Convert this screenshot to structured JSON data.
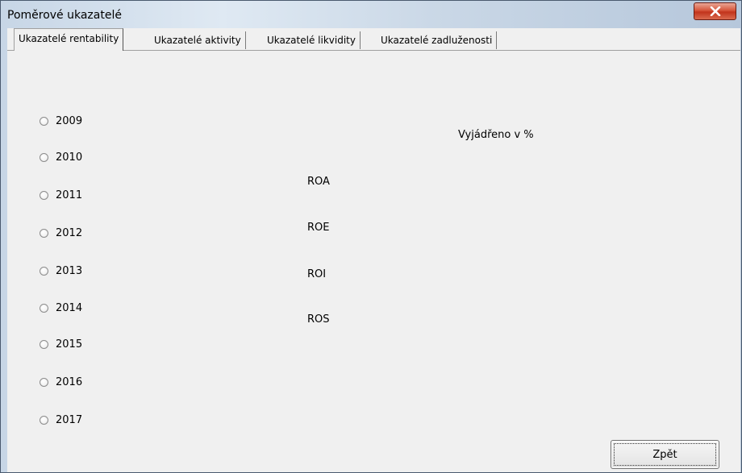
{
  "window": {
    "title": "Poměrové ukazatelé",
    "close_icon": "close-x-icon",
    "close_color": "#c7442b"
  },
  "tabs": [
    {
      "label": "Ukazatelé rentability",
      "active": true
    },
    {
      "label": "Ukazatelé aktivity",
      "active": false
    },
    {
      "label": "Ukazatelé likvidity",
      "active": false
    },
    {
      "label": "Ukazatelé zadluženosti",
      "active": false
    }
  ],
  "years": [
    "2009",
    "2010",
    "2011",
    "2012",
    "2013",
    "2014",
    "2015",
    "2016",
    "2017"
  ],
  "selected_year": null,
  "unit_note": "Vyjádřeno v %",
  "indicators": [
    "ROA",
    "ROE",
    "ROI",
    "ROS"
  ],
  "back_button": "Zpět"
}
